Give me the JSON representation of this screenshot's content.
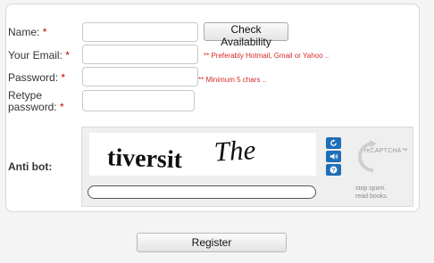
{
  "form": {
    "name_label": "Name:",
    "email_label": "Your Email:",
    "password_label": "Password:",
    "retype_label_line1": "Retype",
    "retype_label_line2": "password:",
    "required_marker": "*",
    "name_value": "",
    "email_value": "",
    "password_value": "",
    "retype_value": "",
    "check_availability_label": "Check Availability",
    "email_hint": "** Preferably Hotmail, Gmail or Yahoo ..",
    "password_hint": "** Minimum 5 chars ..",
    "antibot_label": "Anti bot:",
    "register_label": "Register"
  },
  "captcha": {
    "word1": "tiversit",
    "word2": "The",
    "response_value": "",
    "brand": "reCAPTCHA",
    "brand_tm": "™",
    "tagline_line1": "stop spam.",
    "tagline_line2": "read books.",
    "accent_color": "#1f6fb8",
    "icons": [
      "refresh-icon",
      "audio-icon",
      "help-icon"
    ]
  },
  "colors": {
    "required": "#cc0000",
    "hint": "#d62a2a"
  }
}
